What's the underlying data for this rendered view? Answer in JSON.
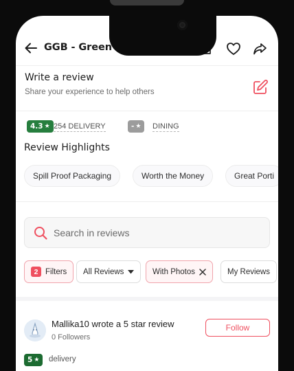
{
  "header": {
    "restaurant_name": "GGB - Green Grain Bowl",
    "icons": [
      "back-arrow-icon",
      "camera-add-icon",
      "heart-icon",
      "share-icon"
    ]
  },
  "write_review": {
    "title": "Write a review",
    "subtitle": "Share your experience to help others",
    "icon": "edit-icon"
  },
  "ratings": {
    "delivery_rating": "4.3",
    "delivery_label": "254 DELIVERY",
    "dining_rating": "-",
    "dining_label": "DINING"
  },
  "highlights": {
    "title": "Review Highlights",
    "chips": [
      "Spill Proof Packaging",
      "Worth the Money",
      "Great Porti"
    ]
  },
  "search": {
    "placeholder": "Search in reviews",
    "value": ""
  },
  "filters": {
    "count": "2",
    "filters_label": "Filters",
    "all_reviews_label": "All Reviews",
    "with_photos_label": "With Photos",
    "my_reviews_label": "My Reviews"
  },
  "review": {
    "reviewer_line": "Mallika10 wrote a 5 star review",
    "followers": "0 Followers",
    "follow_label": "Follow",
    "rating": "5",
    "type": "delivery"
  },
  "colors": {
    "accent": "#ef4f5f",
    "rating_green": "#267e3e",
    "rating_grey": "#9c9c9c"
  }
}
